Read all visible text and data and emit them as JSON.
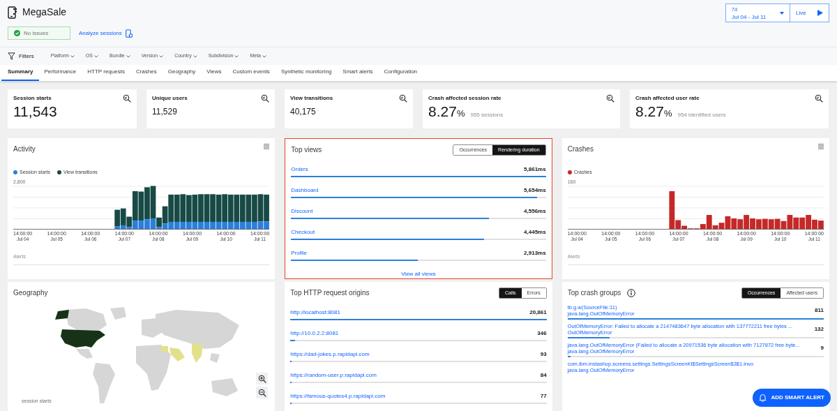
{
  "app": {
    "title": "MegaSale"
  },
  "status": {
    "label": "No issues",
    "ok": true
  },
  "analyze_link": "Analyze sessions",
  "time_range": {
    "preset": "7d",
    "range": "Jul 04 - Jul 11"
  },
  "live_button": "Live",
  "filters": {
    "label": "Filters",
    "items": [
      "Platform",
      "OS",
      "Bundle",
      "Version",
      "Country",
      "Subdivision",
      "Meta"
    ]
  },
  "tabs": [
    {
      "label": "Summary",
      "selected": true
    },
    {
      "label": "Performance",
      "selected": false
    },
    {
      "label": "HTTP requests",
      "selected": false
    },
    {
      "label": "Crashes",
      "selected": false
    },
    {
      "label": "Geography",
      "selected": false
    },
    {
      "label": "Views",
      "selected": false
    },
    {
      "label": "Custom events",
      "selected": false
    },
    {
      "label": "Synthetic monitoring",
      "selected": false
    },
    {
      "label": "Smart alerts",
      "selected": false
    },
    {
      "label": "Configuration",
      "selected": false
    }
  ],
  "stats": [
    {
      "kind": "large",
      "title": "Session starts",
      "value": "11,543"
    },
    {
      "kind": "medium",
      "title": "Unique users",
      "value": "11,529"
    },
    {
      "kind": "medium",
      "title": "View transitions",
      "value": "40,175"
    },
    {
      "kind": "rate",
      "title": "Crash affected session rate",
      "value": "8.27",
      "unit": "%",
      "detail": "955 sessions"
    },
    {
      "kind": "rate",
      "title": "Crash affected user rate",
      "value": "8.27",
      "unit": "%",
      "detail": "954 identified users"
    }
  ],
  "activity": {
    "title": "Activity",
    "legend": [
      {
        "label": "Session starts",
        "color": "#2a7fdc"
      },
      {
        "label": "View transitions",
        "color": "#174a45"
      }
    ],
    "y_label": "2,800",
    "x_labels": [
      {
        "time": "14:00:00",
        "date": "Jul 04"
      },
      {
        "time": "14:00:00",
        "date": "Jul 05"
      },
      {
        "time": "14:00:00",
        "date": "Jul 06"
      },
      {
        "time": "14:00:00",
        "date": "Jul 07"
      },
      {
        "time": "14:00:00",
        "date": "Jul 08"
      },
      {
        "time": "14:00:00",
        "date": "Jul 09"
      },
      {
        "time": "14:00:00",
        "date": "Jul 10"
      },
      {
        "time": "14:00:00",
        "date": "Jul 11"
      }
    ],
    "alerts_label": "Alerts"
  },
  "top_views": {
    "title": "Top views",
    "highlighted": true,
    "toggle": [
      {
        "label": "Occurrences",
        "selected": false
      },
      {
        "label": "Rendering duration",
        "selected": true
      }
    ],
    "rows": [
      {
        "name": "Orders",
        "value": "5,861ms",
        "level": 1.0
      },
      {
        "name": "Dashboard",
        "value": "5,654ms",
        "level": 0.965
      },
      {
        "name": "Discount",
        "value": "4,556ms",
        "level": 0.777
      },
      {
        "name": "Checkout",
        "value": "4,445ms",
        "level": 0.758
      },
      {
        "name": "Profile",
        "value": "2,913ms",
        "level": 0.497
      }
    ],
    "footer_link": "View all views"
  },
  "crashes": {
    "title": "Crashes",
    "legend": [
      {
        "label": "Crashes",
        "color": "#c62828"
      }
    ],
    "y_label": "160",
    "x_labels": [
      {
        "time": "14:00:00",
        "date": "Jul 04"
      },
      {
        "time": "14:00:00",
        "date": "Jul 05"
      },
      {
        "time": "14:00:00",
        "date": "Jul 06"
      },
      {
        "time": "14:00:00",
        "date": "Jul 07"
      },
      {
        "time": "14:00:00",
        "date": "Jul 08"
      },
      {
        "time": "14:00:00",
        "date": "Jul 09"
      },
      {
        "time": "14:00:00",
        "date": "Jul 10"
      },
      {
        "time": "14:00:00",
        "date": "Jul 11"
      }
    ],
    "alerts_label": "Alerts"
  },
  "geography": {
    "title": "Geography",
    "legend_label": "session starts"
  },
  "http_origins": {
    "title": "Top HTTP request origins",
    "toggle": [
      {
        "label": "Calls",
        "selected": true
      },
      {
        "label": "Errors",
        "selected": false
      }
    ],
    "rows": [
      {
        "name": "http://localhost:8081",
        "value": "20,861",
        "level": 1.0
      },
      {
        "name": "http://10.0.2.2:8081",
        "value": "346",
        "level": 0.017
      },
      {
        "name": "https://dad-jokes.p.rapidapi.com",
        "value": "93",
        "level": 0.0045
      },
      {
        "name": "https://random-user.p.rapidapi.com",
        "value": "84",
        "level": 0.004
      },
      {
        "name": "https://famous-quotes4.p.rapidapi.com",
        "value": "77",
        "level": 0.0037
      }
    ]
  },
  "crash_groups": {
    "title": "Top crash groups",
    "toggle": [
      {
        "label": "Occurrences",
        "selected": true
      },
      {
        "label": "Affected users",
        "selected": false
      }
    ],
    "rows": [
      {
        "title": "tb.g.w(SourceFile:11)",
        "subtitle": "java.lang.OutOfMemoryError",
        "count": "811",
        "level": 1.0
      },
      {
        "title": "OutOfMemoryError: Failed to allocate a 2147483647 byte allocation with 137772211 free bytes ...",
        "subtitle": "OutOfMemoryError",
        "count": "132",
        "level": 0.163
      },
      {
        "title": "java.lang.OutOfMemoryError (Failed to allocate a 20971536 byte allocation with 7127872 free byte...",
        "subtitle": "java.lang.OutOfMemoryError",
        "count": "9",
        "level": 0.011
      },
      {
        "title": "com.ibm.instashop.screens.settings.SettingsScreenKt$SettingsScreen$3$1.invo",
        "subtitle": "java.lang.OutOfMemoryError"
      }
    ]
  },
  "smart_alert_button": "ADD SMART ALERT"
}
